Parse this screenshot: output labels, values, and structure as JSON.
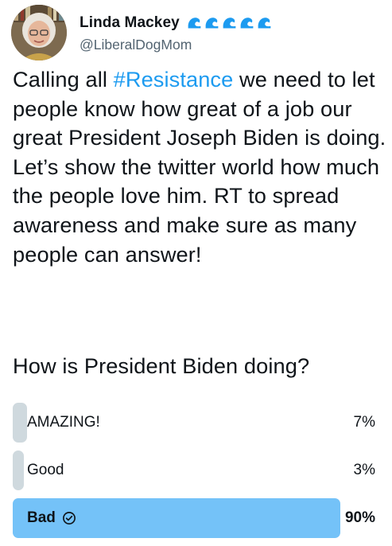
{
  "author": {
    "display_name": "Linda Mackey",
    "handle": "@LiberalDogMom",
    "badge_icons": [
      "wave-icon",
      "wave-icon",
      "wave-icon",
      "wave-icon",
      "wave-icon"
    ],
    "badge_color": "#1d9bf0"
  },
  "tweet": {
    "text_before": "Calling all ",
    "hashtag": "#Resistance",
    "text_after": " we need to let people know how great of a job our great President Joseph Biden is doing. Let’s show the twitter world how much the people love him. RT to spread awareness and make sure as many people can answer!",
    "question": "How is President Biden doing?",
    "hashtag_color": "#1d9bf0"
  },
  "poll": {
    "options": [
      {
        "label": "AMAZING!",
        "percent_text": "7%",
        "percent": 7,
        "winner": false
      },
      {
        "label": "Good",
        "percent_text": "3%",
        "percent": 3,
        "winner": false
      },
      {
        "label": "Bad",
        "percent_text": "90%",
        "percent": 90,
        "winner": true
      }
    ],
    "bar_color": "#cfd9de",
    "winner_bar_color": "#74c2f8"
  }
}
